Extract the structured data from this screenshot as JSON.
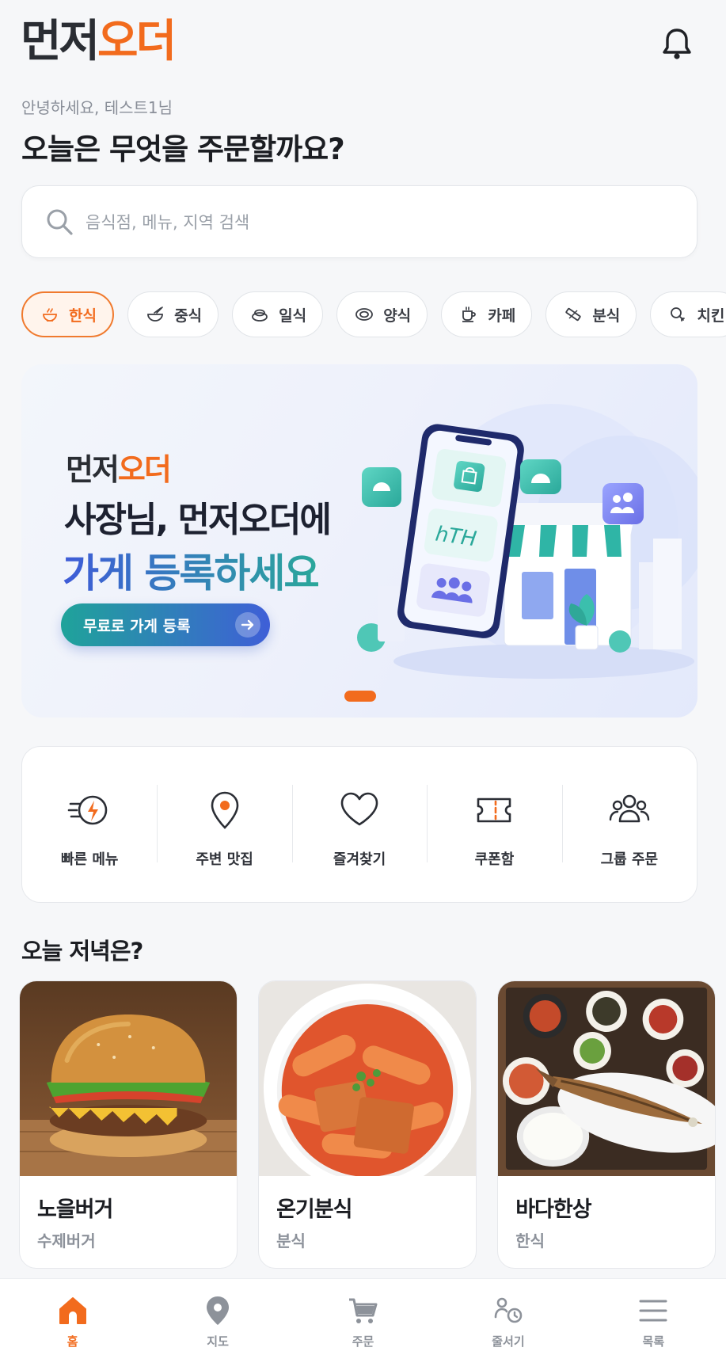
{
  "header": {
    "logo_part1": "먼저",
    "logo_part2": "오더",
    "bell_icon": "bell-icon"
  },
  "greeting": "안녕하세요, 테스트1님",
  "headline": "오늘은 무엇을 주문할까요?",
  "search": {
    "placeholder": "음식점, 메뉴, 지역 검색",
    "icon": "search-icon"
  },
  "categories": [
    {
      "label": "한식",
      "icon": "rice-bowl-icon",
      "active": true
    },
    {
      "label": "중식",
      "icon": "noodle-bowl-icon",
      "active": false
    },
    {
      "label": "일식",
      "icon": "sushi-icon",
      "active": false
    },
    {
      "label": "양식",
      "icon": "plate-icon",
      "active": false
    },
    {
      "label": "카페",
      "icon": "coffee-cup-icon",
      "active": false
    },
    {
      "label": "분식",
      "icon": "kimbap-icon",
      "active": false
    },
    {
      "label": "치킨",
      "icon": "chicken-leg-icon",
      "active": false
    }
  ],
  "banner": {
    "brand_part1": "먼저",
    "brand_part2": "오더",
    "title_line1": "사장님, 먼저오더에",
    "title_line2": "가게 등록하세요",
    "cta_label": "무료로 가게 등록",
    "illustration": "phone-and-storefront-illustration",
    "slide_index": 1,
    "slide_count": 1
  },
  "quick_menu": [
    {
      "label": "빠른 메뉴",
      "icon": "lightning-icon"
    },
    {
      "label": "주변 맛집",
      "icon": "map-pin-icon"
    },
    {
      "label": "즐겨찾기",
      "icon": "heart-icon"
    },
    {
      "label": "쿠폰함",
      "icon": "coupon-icon"
    },
    {
      "label": "그룹 주문",
      "icon": "group-icon"
    }
  ],
  "section": {
    "title": "오늘 저녁은?"
  },
  "restaurants": [
    {
      "name": "노을버거",
      "category": "수제버거",
      "photo": "burger-photo"
    },
    {
      "name": "온기분식",
      "category": "분식",
      "photo": "tteokbokki-photo"
    },
    {
      "name": "바다한상",
      "category": "한식",
      "photo": "grilled-fish-set-photo"
    }
  ],
  "tabbar": [
    {
      "label": "홈",
      "icon": "home-icon",
      "active": true
    },
    {
      "label": "지도",
      "icon": "map-pin-icon",
      "active": false
    },
    {
      "label": "주문",
      "icon": "cart-icon",
      "active": false
    },
    {
      "label": "줄서기",
      "icon": "queue-icon",
      "active": false
    },
    {
      "label": "목록",
      "icon": "menu-icon",
      "active": false
    }
  ],
  "colors": {
    "accent": "#f26b1d",
    "background": "#f6f7f9",
    "banner_gradient_start": "#1fa39a",
    "banner_gradient_end": "#3f5fd7"
  }
}
